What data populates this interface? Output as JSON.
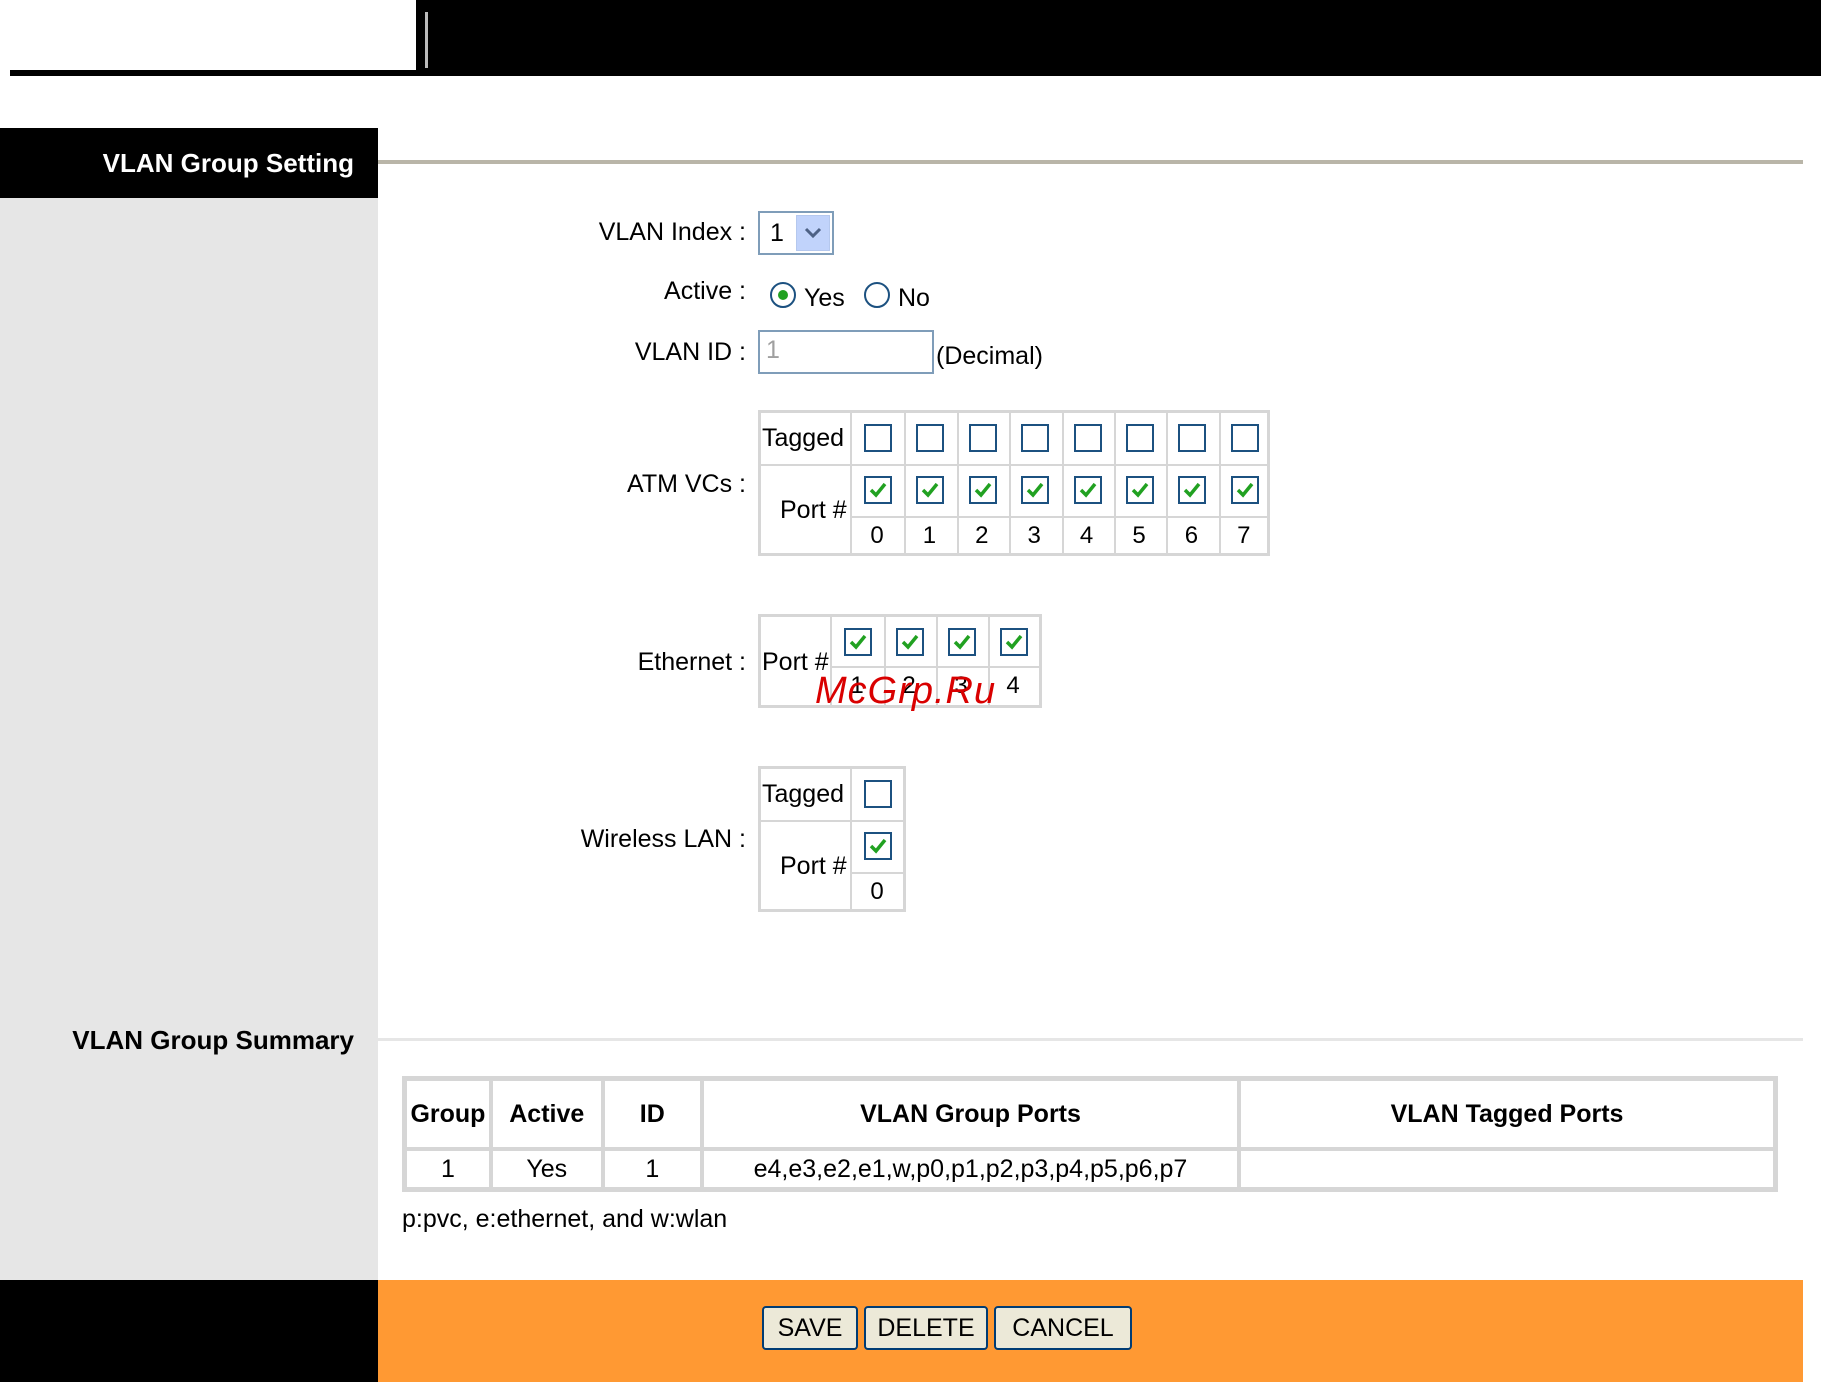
{
  "sidebar": {
    "setting_title": "VLAN Group Setting",
    "summary_title": "VLAN Group Summary"
  },
  "form": {
    "vlan_index_label": "VLAN Index :",
    "vlan_index_value": "1",
    "active_label": "Active :",
    "active_yes": "Yes",
    "active_no": "No",
    "active_selected": "Yes",
    "vlan_id_label": "VLAN ID :",
    "vlan_id_value": "1",
    "vlan_id_suffix": "(Decimal)",
    "atm_label": "ATM VCs :",
    "ethernet_label": "Ethernet :",
    "wlan_label": "Wireless LAN :",
    "tagged_label": "Tagged",
    "port_label": "Port #",
    "atm_ports": [
      "0",
      "1",
      "2",
      "3",
      "4",
      "5",
      "6",
      "7"
    ],
    "atm_tagged": [
      false,
      false,
      false,
      false,
      false,
      false,
      false,
      false
    ],
    "atm_member": [
      true,
      true,
      true,
      true,
      true,
      true,
      true,
      true
    ],
    "eth_ports": [
      "1",
      "2",
      "3",
      "4"
    ],
    "eth_member": [
      true,
      true,
      true,
      true
    ],
    "wlan_ports": [
      "0"
    ],
    "wlan_tagged": [
      false
    ],
    "wlan_member": [
      true
    ]
  },
  "watermark": "McGrp.Ru",
  "summary": {
    "headers": [
      "Group",
      "Active",
      "ID",
      "VLAN Group Ports",
      "VLAN Tagged Ports"
    ],
    "rows": [
      [
        "1",
        "Yes",
        "1",
        "e4,e3,e2,e1,w,p0,p1,p2,p3,p4,p5,p6,p7",
        ""
      ]
    ],
    "note": "p:pvc, e:ethernet, and w:wlan"
  },
  "buttons": {
    "save": "SAVE",
    "delete": "DELETE",
    "cancel": "CANCEL"
  },
  "colors": {
    "footer_orange": "#ff9933",
    "check_green": "#21a121",
    "control_border": "#1c5180"
  }
}
